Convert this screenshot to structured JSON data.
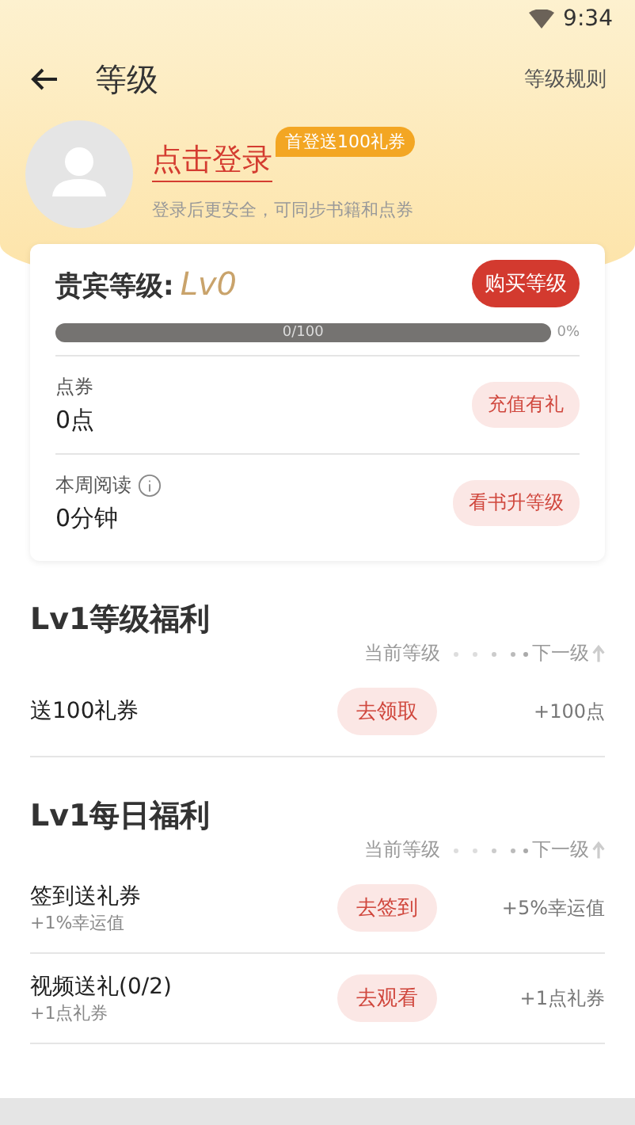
{
  "status_bar": {
    "time": "9:34"
  },
  "header": {
    "title": "等级",
    "rules_link": "等级规则"
  },
  "profile": {
    "login": "点击登录",
    "badge": "首登送100礼券",
    "hint": "登录后更安全，可同步书籍和点券"
  },
  "vip_card": {
    "label": "贵宾等级:",
    "level_name": "Lv0",
    "buy_button": "购买等级",
    "progress": {
      "level": 0,
      "reading": "0/100",
      "percent": "0%"
    },
    "stats": [
      {
        "label": "点券",
        "value": "0点",
        "button": "充值有礼",
        "info": false
      },
      {
        "label": "本周阅读",
        "value": "0分钟",
        "button": "看书升等级",
        "info": true
      }
    ]
  },
  "sections": [
    {
      "title": "Lv1等级福利",
      "current": "当前等级",
      "next": "下一级",
      "rows": [
        {
          "name": "送100礼券",
          "button": "去领取",
          "reward": "+100点"
        }
      ]
    },
    {
      "title": "Lv1每日福利",
      "current": "当前等级",
      "next": "下一级",
      "rows": [
        {
          "name": "签到送礼券",
          "sub": "+1%幸运值",
          "button": "去签到",
          "reward": "+5%幸运值"
        },
        {
          "name": "视频送礼(0/2)",
          "sub": "+1点礼券",
          "button": "去观看",
          "reward": "+1点礼券"
        }
      ]
    }
  ]
}
